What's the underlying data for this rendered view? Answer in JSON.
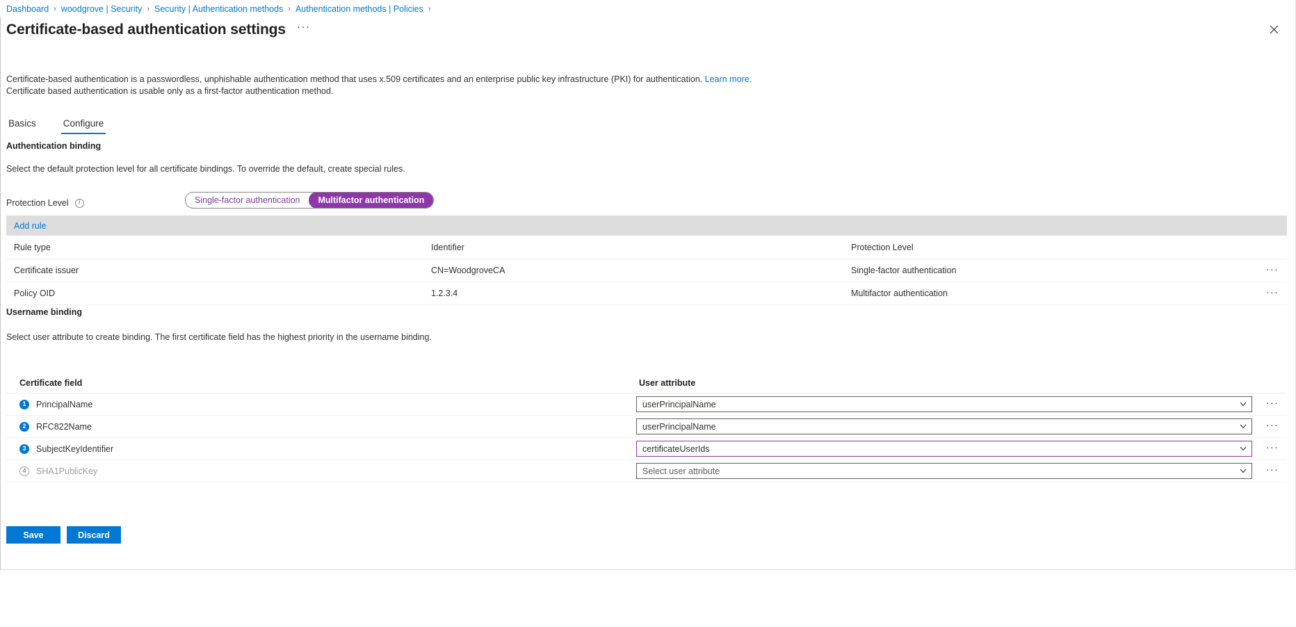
{
  "breadcrumb": {
    "items": [
      "Dashboard",
      "woodgrove | Security",
      "Security | Authentication methods",
      "Authentication methods | Policies"
    ],
    "separator": "›"
  },
  "header": {
    "title": "Certificate-based authentication settings",
    "ellipsis": "···",
    "close_icon": "close-icon"
  },
  "description": {
    "line1_before_link": "Certificate-based authentication is a passwordless, unphishable authentication method that uses x.509 certificates and an enterprise public key infrastructure (PKI) for authentication. ",
    "link_text": "Learn more",
    "line1_after_link": ".",
    "line2": "Certificate based authentication is usable only as a first-factor authentication method."
  },
  "tabs": [
    {
      "label": "Basics",
      "active": false
    },
    {
      "label": "Configure",
      "active": true
    }
  ],
  "authentication_binding": {
    "heading": "Authentication binding",
    "description": "Select the default protection level for all certificate bindings. To override the default, create special rules.",
    "protection_level_label": "Protection Level",
    "info_glyph": "i",
    "options": [
      {
        "label": "Single-factor authentication",
        "selected": false
      },
      {
        "label": "Multifactor authentication",
        "selected": true
      }
    ],
    "selected_color": "#8f36ab",
    "unselected_text_color": "#7a3f9d"
  },
  "command_bar": {
    "add_rule_label": "Add rule"
  },
  "rules_table": {
    "columns": [
      "Rule type",
      "Identifier",
      "Protection Level"
    ],
    "rows": [
      {
        "rule_type": "Certificate issuer",
        "identifier": "CN=WoodgroveCA",
        "protection_level": "Single-factor authentication",
        "kebab": "···"
      },
      {
        "rule_type": "Policy OID",
        "identifier": "1.2.3.4",
        "protection_level": "Multifactor authentication",
        "kebab": "···"
      }
    ]
  },
  "username_binding": {
    "heading": "Username binding",
    "description": "Select user attribute to create binding. The first certificate field has the highest priority in the username binding.",
    "columns": [
      "Certificate field",
      "User attribute"
    ],
    "rows": [
      {
        "order": "1",
        "certificate_field": "PrincipalName",
        "user_attribute": "userPrincipalName",
        "placeholder": "Select user attribute",
        "is_placeholder": false,
        "disabled": false,
        "focused": false,
        "kebab": "···"
      },
      {
        "order": "2",
        "certificate_field": "RFC822Name",
        "user_attribute": "userPrincipalName",
        "placeholder": "Select user attribute",
        "is_placeholder": false,
        "disabled": false,
        "focused": false,
        "kebab": "···"
      },
      {
        "order": "3",
        "certificate_field": "SubjectKeyIdentifier",
        "user_attribute": "certificateUserIds",
        "placeholder": "Select user attribute",
        "is_placeholder": false,
        "disabled": false,
        "focused": true,
        "kebab": "···"
      },
      {
        "order": "4",
        "certificate_field": "SHA1PublicKey",
        "user_attribute": "Select user attribute",
        "placeholder": "Select user attribute",
        "is_placeholder": true,
        "disabled": true,
        "focused": false,
        "kebab": "···"
      }
    ]
  },
  "footer": {
    "save_label": "Save",
    "discard_label": "Discard"
  },
  "colors": {
    "accent": "#0078d4",
    "purple": "#8f36ab",
    "command_bar_bg": "#dddddd",
    "text": "#323130"
  }
}
